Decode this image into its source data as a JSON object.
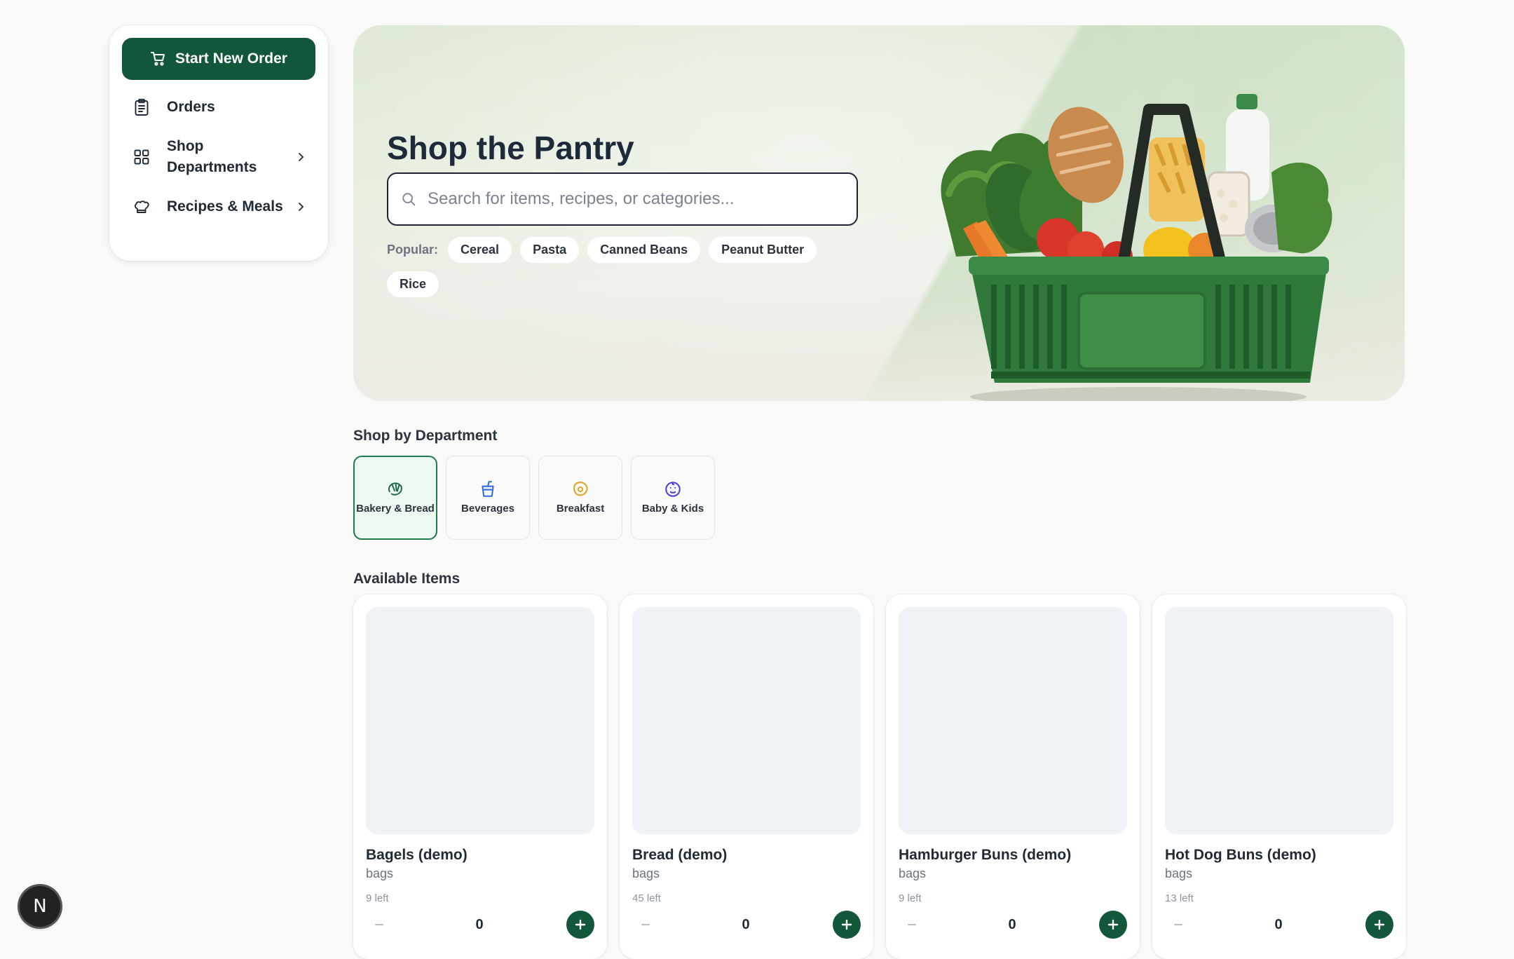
{
  "sidebar": {
    "start_order": "Start New Order",
    "items": [
      {
        "label": "Orders",
        "icon": "clipboard-icon"
      },
      {
        "label": "Shop Departments",
        "icon": "grid-icon",
        "has_chevron": true
      },
      {
        "label": "Recipes & Meals",
        "icon": "chef-hat-icon",
        "has_chevron": true
      }
    ]
  },
  "hero": {
    "title": "Shop the Pantry",
    "search_placeholder": "Search for items, recipes, or categories...",
    "popular_label": "Popular:",
    "popular": [
      "Cereal",
      "Pasta",
      "Canned Beans",
      "Peanut Butter",
      "Rice"
    ]
  },
  "departments": {
    "title": "Shop by Department",
    "items": [
      {
        "label": "Bakery & Bread",
        "icon": "croissant-icon",
        "color": "#1d6b45",
        "active": true
      },
      {
        "label": "Beverages",
        "icon": "cup-icon",
        "color": "#2f6fd8"
      },
      {
        "label": "Breakfast",
        "icon": "egg-icon",
        "color": "#e0a42a"
      },
      {
        "label": "Baby & Kids",
        "icon": "baby-icon",
        "color": "#4b3fd6"
      }
    ]
  },
  "available": {
    "title": "Available Items",
    "items": [
      {
        "name": "Bagels (demo)",
        "unit": "bags",
        "left": "9 left",
        "qty": "0"
      },
      {
        "name": "Bread (demo)",
        "unit": "bags",
        "left": "45 left",
        "qty": "0"
      },
      {
        "name": "Hamburger Buns (demo)",
        "unit": "bags",
        "left": "9 left",
        "qty": "0"
      },
      {
        "name": "Hot Dog Buns (demo)",
        "unit": "bags",
        "left": "13 left",
        "qty": "0"
      }
    ]
  },
  "badge": {
    "letter": "N"
  },
  "colors": {
    "primary": "#13573a",
    "active_bg": "#ecf8f0",
    "background": "#f9f9f8"
  }
}
